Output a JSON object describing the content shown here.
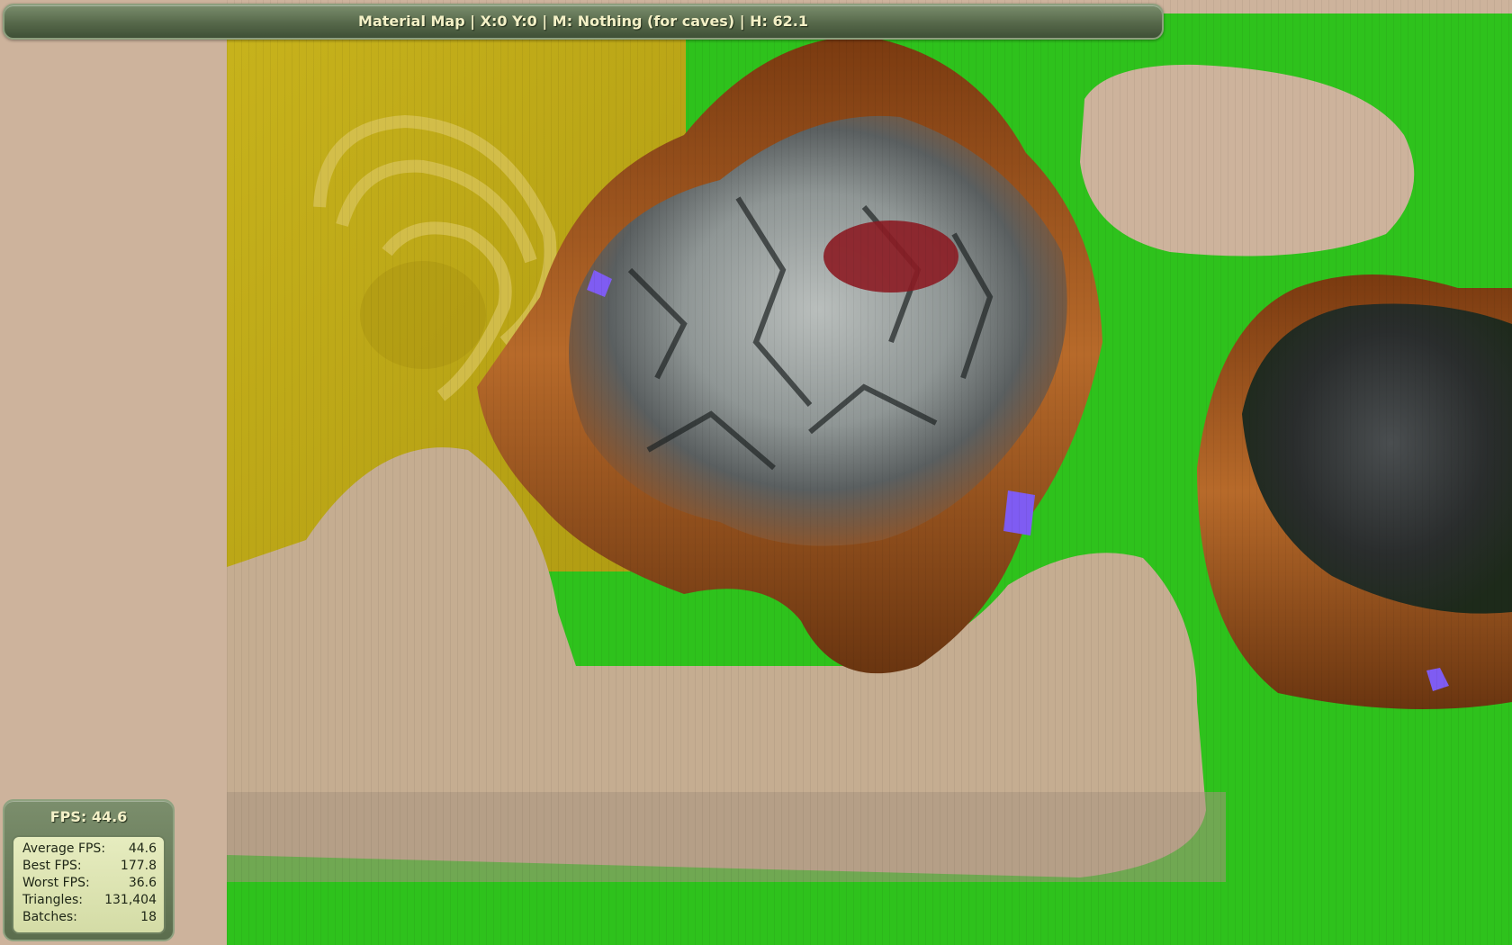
{
  "status_bar": {
    "text": "Material Map | X:0 Y:0 | M: Nothing (for caves) | H: 62.1"
  },
  "fps_panel": {
    "title": "FPS: 44.6",
    "stats": [
      {
        "label": "Average FPS:",
        "value": "44.6"
      },
      {
        "label": "Best FPS:",
        "value": "177.8"
      },
      {
        "label": "Worst FPS:",
        "value": "36.6"
      },
      {
        "label": "Triangles:",
        "value": "131,404"
      },
      {
        "label": "Batches:",
        "value": "18"
      }
    ]
  },
  "colors": {
    "ground_sand": "#cdb39c",
    "yellow_region": "#c2ad16",
    "grass": "#2ec21c",
    "rock_brown": "#a65a1c",
    "rock_grey": "#9aa1a1",
    "accent_red": "#8c1c24",
    "water_violet": "#7f5cf2",
    "hud_green": "#5b6d4d",
    "hud_text": "#f3f0c6"
  }
}
